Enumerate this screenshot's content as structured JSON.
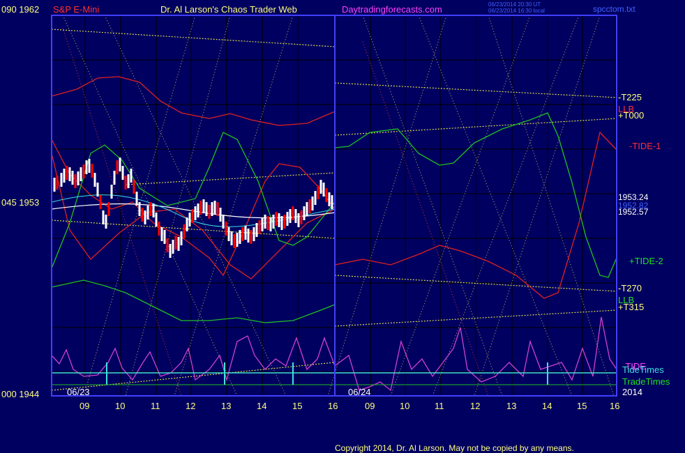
{
  "header": {
    "price_high_label": "090  1962",
    "instrument": "S&P E-Mini",
    "title": "Dr. Al Larson's Chaos Trader Web",
    "website": "Daytradingforecasts.com",
    "timestamp_1": "06/23/2014 20:30 UT",
    "timestamp_2": "06/23/2014 16:30 local",
    "filename": "spcctom.txt"
  },
  "left_axis": {
    "mid_label": "045  1953",
    "low_label": "000  1944"
  },
  "right_labels": {
    "t225": "-T225",
    "llb_top": "LLB",
    "t000": "+T000",
    "tide1": "-TIDE-1",
    "p1": "1953.24",
    "p2": "1952.82",
    "p3": "1952.57",
    "tide2": "+TIDE-2",
    "t270": "-T270",
    "llb_bottom": "LLB",
    "t315": "+T315",
    "tide_overlap": "-TIDE",
    "tidetimes": "TideTimes",
    "tradetimes": "TradeTimes",
    "year": "2014"
  },
  "date_labels": {
    "day1": "06/23",
    "day2": "06/24"
  },
  "copyright": "Copyright 2014, Dr. Al Larson. May not be copied by any means.",
  "colors": {
    "background": "#000060",
    "frame": "#4040ff",
    "grid": "#000000",
    "price_up": "#ffffff",
    "price_down": "#ff0000",
    "red_band": "#e02020",
    "green_band": "#20c020",
    "yellow_line": "#d8d850",
    "tide": "#d040d0",
    "cyan": "#40e0e0",
    "white_ma": "#ffffff",
    "label_yellow": "#ffff80",
    "label_green": "#20e020",
    "label_white": "#ffffff",
    "label_red": "#ff3030",
    "label_magenta": "#ff40ff"
  },
  "chart_data": {
    "type": "line",
    "title": "Dr. Al Larson's Chaos Trader Web",
    "instrument": "S&P E-Mini",
    "x_tick_labels": [
      "09",
      "10",
      "11",
      "12",
      "13",
      "14",
      "15",
      "16",
      "09",
      "10",
      "11",
      "12",
      "13",
      "14",
      "15",
      "16"
    ],
    "sessions": [
      "06/23",
      "06/24"
    ],
    "ylim": [
      1944,
      1962
    ],
    "y_ticks": [
      {
        "value": 1962,
        "label": "090  1962"
      },
      {
        "value": 1953,
        "label": "045  1953"
      },
      {
        "value": 1944,
        "label": "000  1944"
      }
    ],
    "price_markers": [
      1953.24,
      1952.82,
      1952.57
    ],
    "grid": true,
    "series_names": [
      "TideTimes",
      "TradeTimes",
      "-TIDE-1",
      "+TIDE-2",
      "-T225",
      "+T000",
      "-T270",
      "+T315",
      "LLB"
    ]
  }
}
